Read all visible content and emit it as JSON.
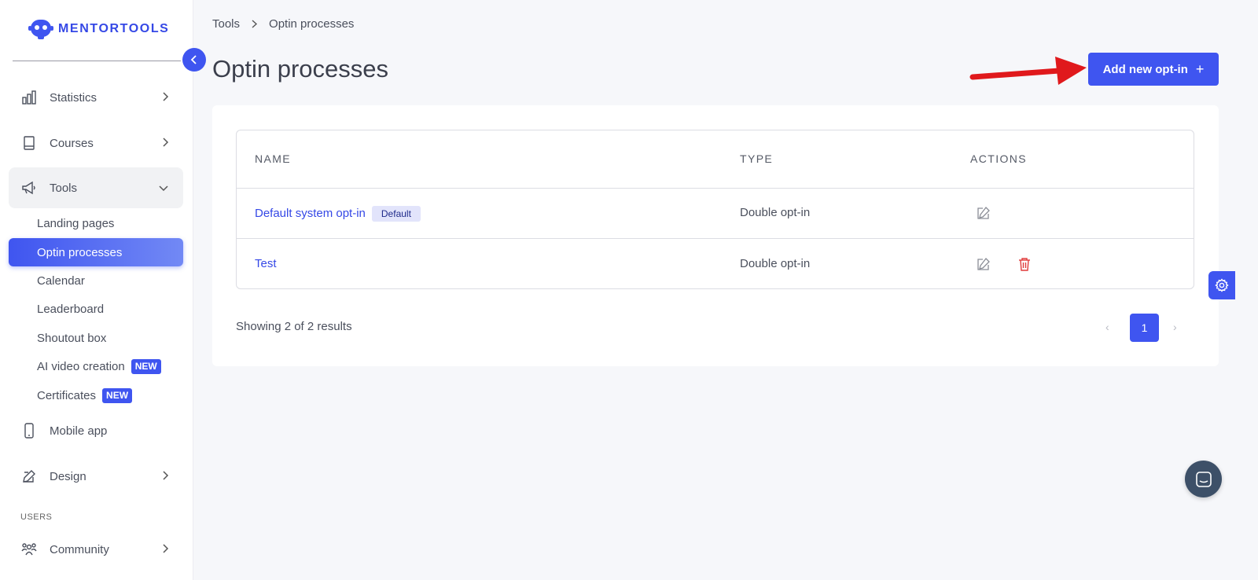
{
  "brand": {
    "name": "MENTORTOOLS"
  },
  "sidebar": {
    "nav": [
      {
        "label": "Statistics",
        "icon": "bar-chart-icon"
      },
      {
        "label": "Courses",
        "icon": "book-icon"
      },
      {
        "label": "Tools",
        "icon": "megaphone-icon",
        "expanded": true
      }
    ],
    "tools_sub": [
      {
        "label": "Landing pages"
      },
      {
        "label": "Optin processes",
        "active": true
      },
      {
        "label": "Calendar"
      },
      {
        "label": "Leaderboard"
      },
      {
        "label": "Shoutout box"
      },
      {
        "label": "AI video creation",
        "badge": "NEW"
      },
      {
        "label": "Certificates",
        "badge": "NEW"
      }
    ],
    "nav_after": [
      {
        "label": "Mobile app",
        "icon": "mobile-icon"
      },
      {
        "label": "Design",
        "icon": "pencil-icon"
      }
    ],
    "section_users": "USERS",
    "community": {
      "label": "Community",
      "icon": "community-icon"
    }
  },
  "breadcrumb": {
    "parent": "Tools",
    "current": "Optin processes"
  },
  "page": {
    "title": "Optin processes",
    "add_button_label": "Add new opt-in",
    "add_button_icon": "+"
  },
  "table": {
    "headers": {
      "name": "NAME",
      "type": "TYPE",
      "actions": "ACTIONS"
    },
    "rows": [
      {
        "name": "Default system opt-in",
        "badge": "Default",
        "type": "Double opt-in",
        "actions": [
          "edit"
        ]
      },
      {
        "name": "Test",
        "type": "Double opt-in",
        "actions": [
          "edit",
          "delete"
        ]
      }
    ]
  },
  "pagination": {
    "summary": "Showing 2 of 2 results",
    "prev": "‹",
    "current_page": "1",
    "next": "›"
  },
  "colors": {
    "accent": "#3f55f0",
    "link": "#3548e6",
    "danger": "#e03c3c",
    "annotation_arrow": "#e0191c"
  }
}
